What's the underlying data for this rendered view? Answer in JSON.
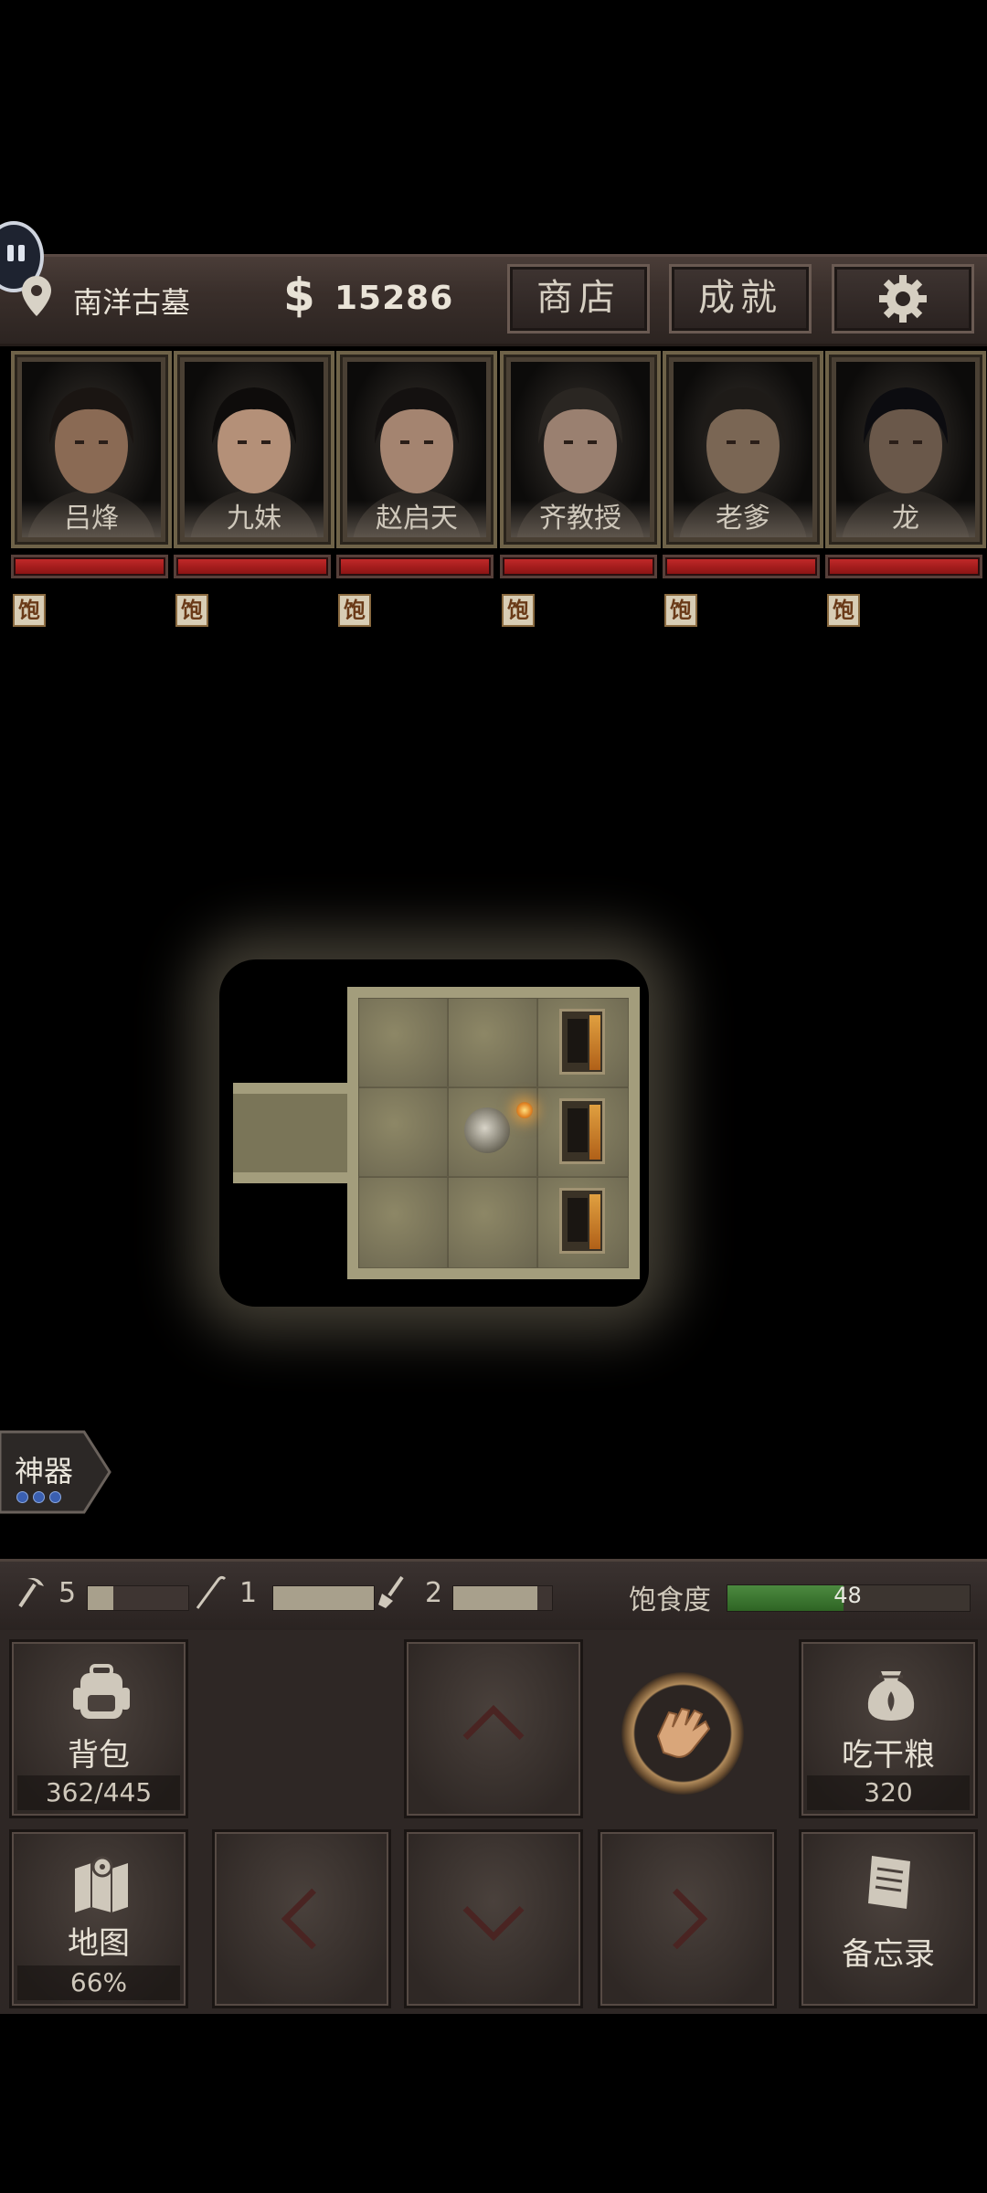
{
  "header": {
    "location": "南洋古墓",
    "money_symbol": "$",
    "money": "15286",
    "shop_label": "商店",
    "achievements_label": "成就"
  },
  "characters": [
    {
      "name": "吕烽",
      "status": "饱",
      "hp": 1.0
    },
    {
      "name": "九妹",
      "status": "饱",
      "hp": 1.0
    },
    {
      "name": "赵启天",
      "status": "饱",
      "hp": 1.0
    },
    {
      "name": "齐教授",
      "status": "饱",
      "hp": 1.0
    },
    {
      "name": "老爹",
      "status": "饱",
      "hp": 1.0
    },
    {
      "name": "龙",
      "status": "饱",
      "hp": 1.0
    }
  ],
  "artifact": {
    "label": "神器",
    "dots": 3
  },
  "tools": [
    {
      "icon": "pickaxe-icon",
      "count": "5",
      "level": 0.25
    },
    {
      "icon": "rope-icon",
      "count": "1",
      "level": 1.0
    },
    {
      "icon": "shovel-icon",
      "count": "2",
      "level": 0.85
    }
  ],
  "hunger": {
    "label": "饱食度",
    "value": "48",
    "level": 0.48
  },
  "controls": {
    "backpack_label": "背包",
    "backpack_capacity": "362/445",
    "eat_label": "吃干粮",
    "eat_count": "320",
    "map_label": "地图",
    "map_progress": "66%",
    "memo_label": "备忘录"
  },
  "colors": {
    "hp": "#c02828",
    "hunger": "#4c8a40",
    "status_badge": "#d8cdb5"
  }
}
